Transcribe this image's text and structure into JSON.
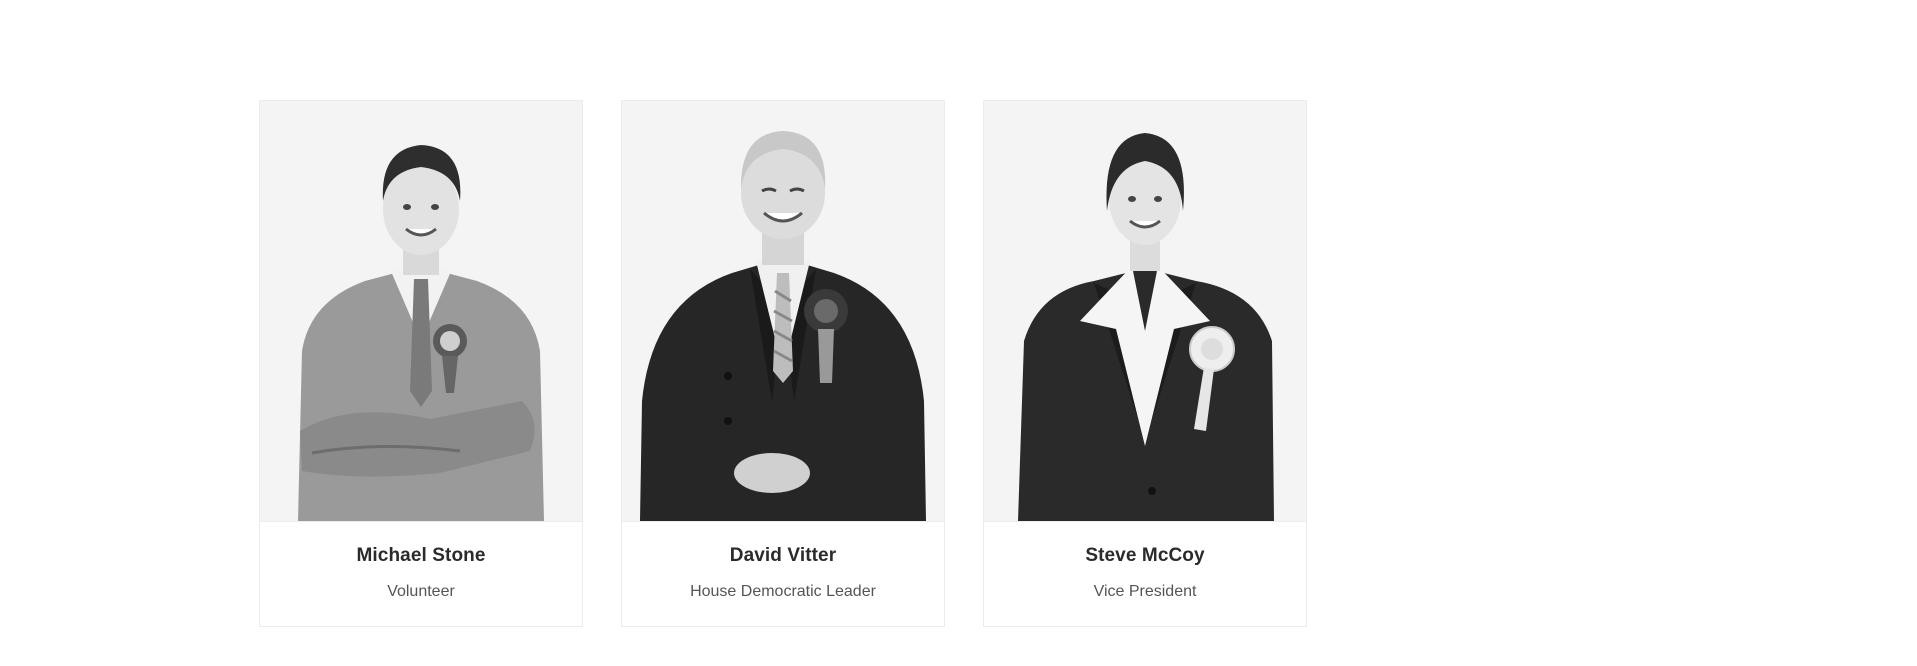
{
  "team": {
    "members": [
      {
        "name": "Michael Stone",
        "role": "Volunteer",
        "photo": "portrait-young-man-grey-suit-rosette"
      },
      {
        "name": "David Vitter",
        "role": "House Democratic Leader",
        "photo": "portrait-older-man-dark-suit-rosette"
      },
      {
        "name": "Steve McCoy",
        "role": "Vice President",
        "photo": "portrait-woman-dark-suit-rosette"
      }
    ]
  },
  "colors": {
    "card_border": "#ececec",
    "photo_background": "#f4f4f4",
    "name_text": "#2b2b2b",
    "role_text": "#555555"
  }
}
